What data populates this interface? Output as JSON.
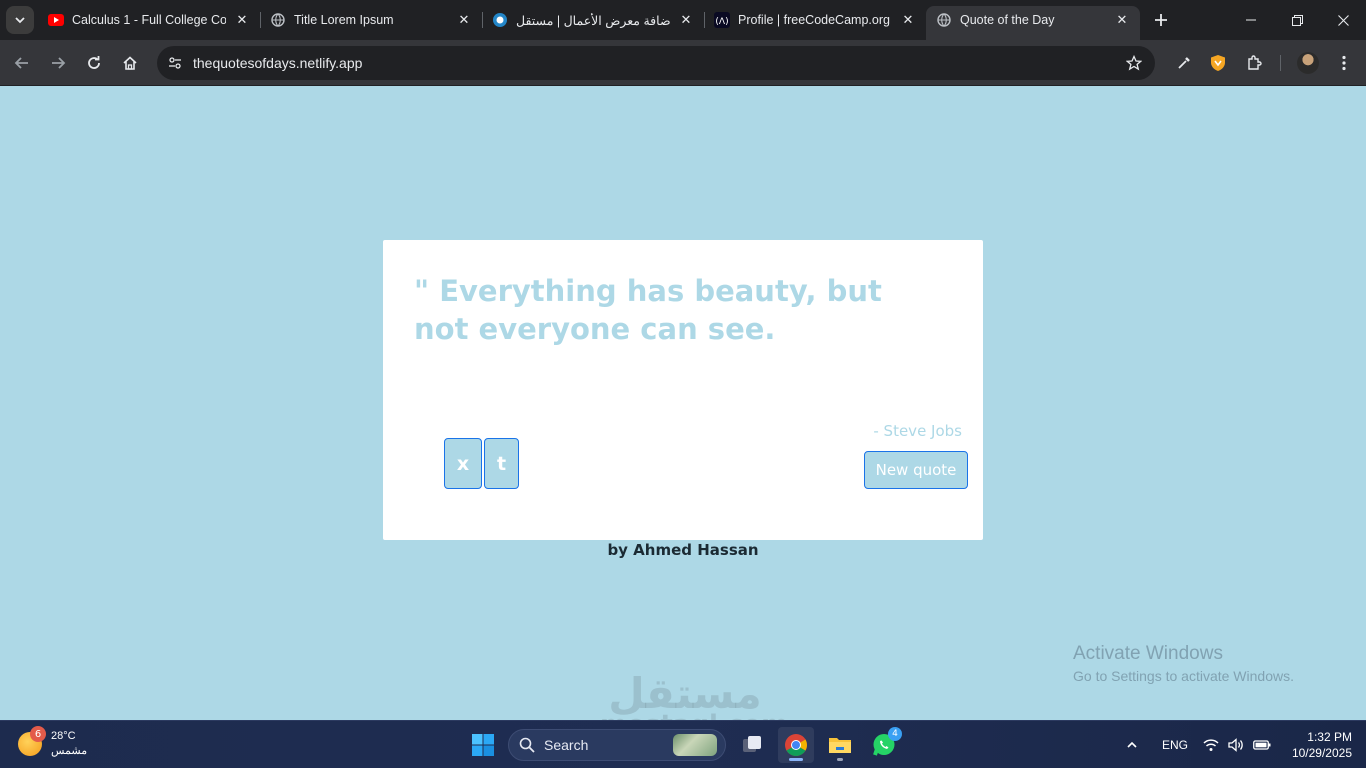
{
  "browser": {
    "tabs": [
      {
        "title": "Calculus 1 - Full College Cou",
        "icon": "youtube-icon",
        "active": false
      },
      {
        "title": "Title Lorem Ipsum",
        "icon": "globe-icon",
        "active": false
      },
      {
        "title": "إضافة معرض الأعمال | مستقل",
        "icon": "mostaql-icon",
        "active": false
      },
      {
        "title": "Profile | freeCodeCamp.org",
        "icon": "freecodecamp-icon",
        "active": false
      },
      {
        "title": "Quote of the Day",
        "icon": "globe-icon",
        "active": true
      }
    ],
    "url": "thequotesofdays.netlify.app"
  },
  "quote": {
    "text": "\" Everything has beauty, but not everyone can see.",
    "author": "- Steve Jobs",
    "share_x_label": "x",
    "share_t_label": "t",
    "new_quote_label": "New quote"
  },
  "footer": {
    "byline": "by Ahmed Hassan"
  },
  "windows_watermark": {
    "line1": "Activate Windows",
    "line2": "Go to Settings to activate Windows."
  },
  "site_watermark": {
    "arabic": "مستقل",
    "latin": "mostaql.com"
  },
  "taskbar": {
    "weather": {
      "temp": "28°C",
      "condition": "مشمس",
      "badge": "6"
    },
    "search_label": "Search",
    "whatsapp_badge": "4",
    "language": "ENG",
    "time": "1:32 PM",
    "date": "10/29/2025"
  },
  "colors": {
    "page_bg": "#add8e6",
    "accent_border": "#1a73e8",
    "chrome_dark": "#202124",
    "chrome_toolbar": "#35363a"
  }
}
